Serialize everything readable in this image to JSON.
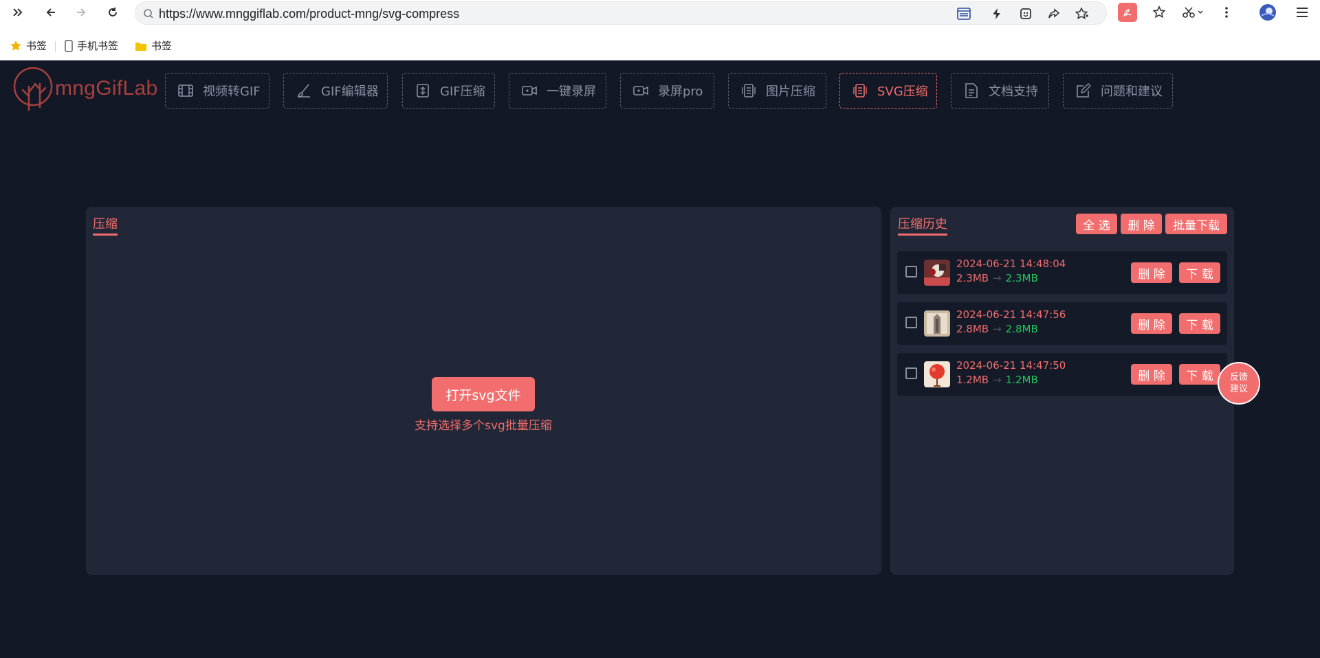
{
  "browser": {
    "url": "https://www.mnggiflab.com/product-mng/svg-compress",
    "bookmarks": [
      {
        "label": "书签"
      },
      {
        "label": "手机书签"
      },
      {
        "label": "书签"
      }
    ]
  },
  "app": {
    "logo_text": "mngGifLab",
    "nav": [
      {
        "label": "视频转GIF",
        "icon": "film-icon"
      },
      {
        "label": "GIF编辑器",
        "icon": "brush-icon"
      },
      {
        "label": "GIF压缩",
        "icon": "compress-icon"
      },
      {
        "label": "一键录屏",
        "icon": "video-record-icon"
      },
      {
        "label": "录屏pro",
        "icon": "video-pro-icon"
      },
      {
        "label": "图片压缩",
        "icon": "image-compress-icon"
      },
      {
        "label": "SVG压缩",
        "icon": "svg-compress-icon",
        "active": true
      },
      {
        "label": "文档支持",
        "icon": "document-icon"
      },
      {
        "label": "问题和建议",
        "icon": "edit-icon"
      }
    ],
    "accent_color": "#f26d6d",
    "success_color": "#22c55e"
  },
  "compress": {
    "title": "压缩",
    "open_button": "打开svg文件",
    "hint": "支持选择多个svg批量压缩"
  },
  "history": {
    "title": "压缩历史",
    "select_all": "全 选",
    "delete": "删 除",
    "batch_download": "批量下载",
    "rows": [
      {
        "time": "2024-06-21 14:48:04",
        "original": "2.3MB",
        "compressed": "2.3MB",
        "delete": "删 除",
        "download": "下 载"
      },
      {
        "time": "2024-06-21 14:47:56",
        "original": "2.8MB",
        "compressed": "2.8MB",
        "delete": "删 除",
        "download": "下 载"
      },
      {
        "time": "2024-06-21 14:47:50",
        "original": "1.2MB",
        "compressed": "1.2MB",
        "delete": "删 除",
        "download": "下 载"
      }
    ]
  },
  "feedback": {
    "line1": "反馈",
    "line2": "建议"
  }
}
